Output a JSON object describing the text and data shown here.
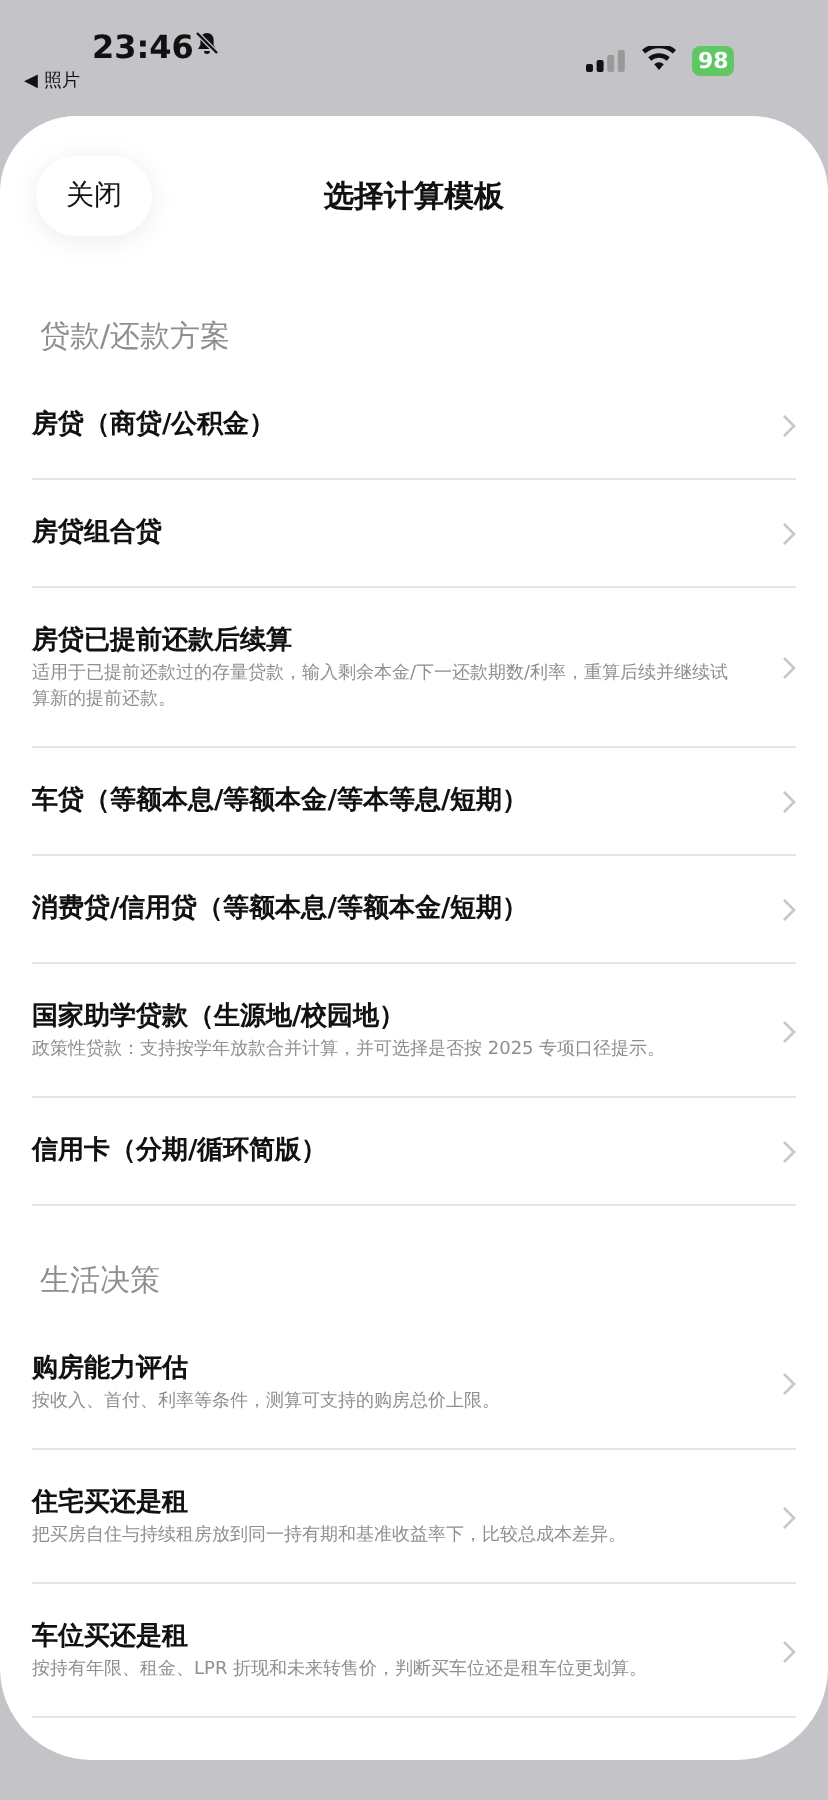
{
  "status_bar": {
    "time": "23:46",
    "back_label": "◀ 照片",
    "battery": "98"
  },
  "header": {
    "close": "关闭",
    "title": "选择计算模板"
  },
  "sections": [
    {
      "title": "贷款/还款方案",
      "items": [
        {
          "title": "房贷（商贷/公积金）"
        },
        {
          "title": "房贷组合贷"
        },
        {
          "title": "房贷已提前还款后续算",
          "subtitle": "适用于已提前还款过的存量贷款，输入剩余本金/下一还款期数/利率，重算后续并继续试算新的提前还款。"
        },
        {
          "title": "车贷（等额本息/等额本金/等本等息/短期）"
        },
        {
          "title": "消费贷/信用贷（等额本息/等额本金/短期）"
        },
        {
          "title": "国家助学贷款（生源地/校园地）",
          "subtitle": "政策性贷款：支持按学年放款合并计算，并可选择是否按 2025 专项口径提示。"
        },
        {
          "title": "信用卡（分期/循环简版）"
        }
      ]
    },
    {
      "title": "生活决策",
      "items": [
        {
          "title": "购房能力评估",
          "subtitle": "按收入、首付、利率等条件，测算可支持的购房总价上限。"
        },
        {
          "title": "住宅买还是租",
          "subtitle": "把买房自住与持续租房放到同一持有期和基准收益率下，比较总成本差异。"
        },
        {
          "title": "车位买还是租",
          "subtitle": "按持有年限、租金、LPR 折现和未来转售价，判断买车位还是租车位更划算。"
        }
      ]
    }
  ]
}
